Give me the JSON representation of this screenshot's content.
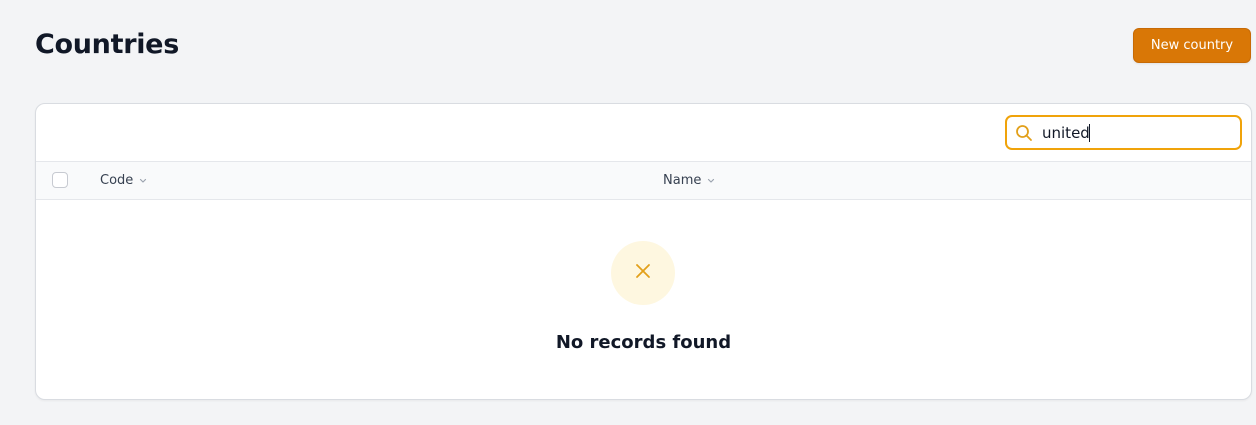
{
  "header": {
    "title": "Countries",
    "new_button_label": "New country"
  },
  "search": {
    "value": "united",
    "icon": "search-icon"
  },
  "table": {
    "columns": [
      {
        "label": "Code",
        "sortable": true
      },
      {
        "label": "Name",
        "sortable": true
      }
    ],
    "rows": [],
    "empty_state": {
      "icon": "x-icon",
      "message": "No records found"
    }
  },
  "colors": {
    "accent": "#d97706",
    "search_border": "#f0a30a",
    "empty_icon_bg": "#fef7e0",
    "empty_icon": "#e2a01a"
  }
}
